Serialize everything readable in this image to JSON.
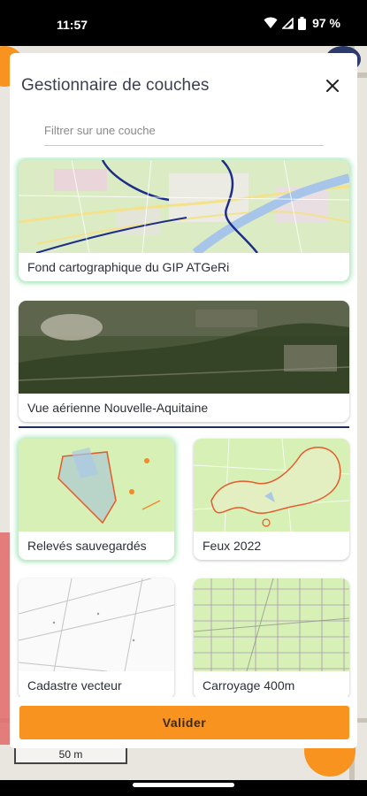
{
  "status": {
    "time": "11:57",
    "battery": "97 %",
    "icons": [
      "wifi-icon",
      "signal-icon",
      "battery-icon"
    ]
  },
  "background": {
    "scale_label": "50 m"
  },
  "modal": {
    "title": "Gestionnaire de couches",
    "filter_placeholder": "Filtrer sur une couche",
    "filter_value": "",
    "layers": [
      {
        "label": "Fond cartographique du GIP ATGeRi",
        "selected": true,
        "thumb": "street-map"
      },
      {
        "label": "Vue aérienne Nouvelle-Aquitaine",
        "selected": false,
        "thumb": "aerial"
      },
      {
        "label": "Relevés sauvegardés",
        "selected": true,
        "thumb": "saved-surveys"
      },
      {
        "label": "Feux 2022",
        "selected": false,
        "thumb": "fires"
      },
      {
        "label": "Cadastre vecteur",
        "selected": false,
        "thumb": "cadastre"
      },
      {
        "label": "Carroyage 400m",
        "selected": false,
        "thumb": "grid"
      }
    ],
    "validate_label": "Valider"
  },
  "colors": {
    "accent": "#f7931e",
    "selected_glow": "#b9ecc7",
    "separator": "#1f2d5a",
    "title": "#3a3f4f"
  }
}
